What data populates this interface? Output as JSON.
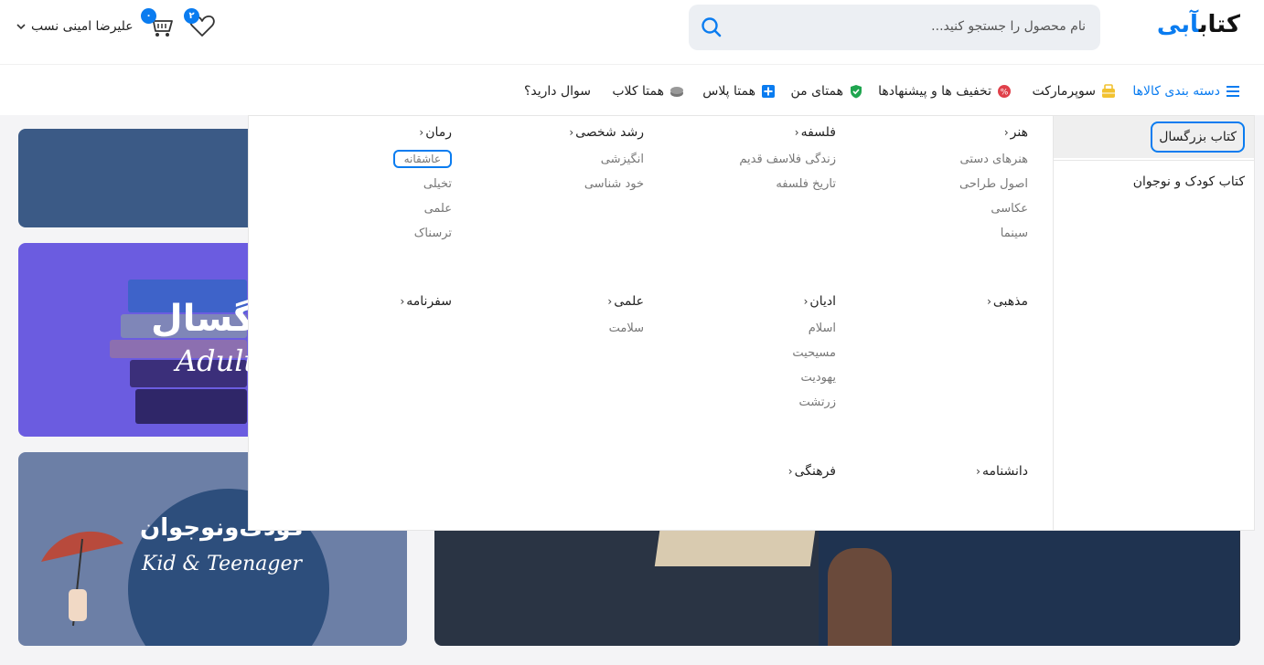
{
  "header": {
    "logo_main": "کتاب",
    "logo_accent": "آبی",
    "search_placeholder": "نام محصول را جستجو کنید...",
    "user_name": "علیرضا امینی نسب",
    "cart_count": "۰",
    "wishlist_count": "۲"
  },
  "nav": {
    "items": [
      {
        "label": "دسته بندی کالاها",
        "icon": "menu-icon"
      },
      {
        "label": "سوپرمارکت",
        "icon": "basket-icon"
      },
      {
        "label": "تخفیف ها و پیشنهادها",
        "icon": "discount-icon"
      },
      {
        "label": "همتای من",
        "icon": "shield-check-icon"
      },
      {
        "label": "همتا پلاس",
        "icon": "plus-square-icon"
      },
      {
        "label": "همتا کلاب",
        "icon": "coin-icon"
      },
      {
        "label": "سوال دارید؟",
        "icon": ""
      }
    ]
  },
  "mega_menu": {
    "side": [
      {
        "label": "کتاب بزرگسال",
        "active": true
      },
      {
        "label": "کتاب کودک و نوجوان",
        "active": false
      }
    ],
    "columns": [
      {
        "title": "هنر",
        "items": [
          "هنرهای دستی",
          "اصول طراحی",
          "عکاسی",
          "سینما"
        ]
      },
      {
        "title": "فلسفه",
        "items": [
          "زندگی فلاسف قدیم",
          "تاریخ فلسفه"
        ]
      },
      {
        "title": "رشد شخصی",
        "items": [
          "انگیزشی",
          "خود شناسی"
        ]
      },
      {
        "title": "رمان",
        "items": [
          "عاشقانه",
          "تخیلی",
          "علمی",
          "ترسناک"
        ]
      },
      {
        "title": "مذهبی",
        "items": []
      },
      {
        "title": "ادیان",
        "items": [
          "اسلام",
          "مسیحیت",
          "یهودیت",
          "زرتشت"
        ]
      },
      {
        "title": "علمی",
        "items": [
          "سلامت"
        ]
      },
      {
        "title": "سفرنامه",
        "items": []
      },
      {
        "title": "دانشنامه",
        "items": []
      },
      {
        "title": "فرهنگی",
        "items": []
      }
    ]
  },
  "banners": {
    "adult_fa": "بزرگسال",
    "adult_en": "Adult",
    "kid_fa": "کودک‌ونوجوان",
    "kid_en": "Kid & Teenager"
  },
  "colors": {
    "accent": "#0a7cf0",
    "adult_banner": "#6b5ce0",
    "kid_banner": "#6c7fa6"
  }
}
